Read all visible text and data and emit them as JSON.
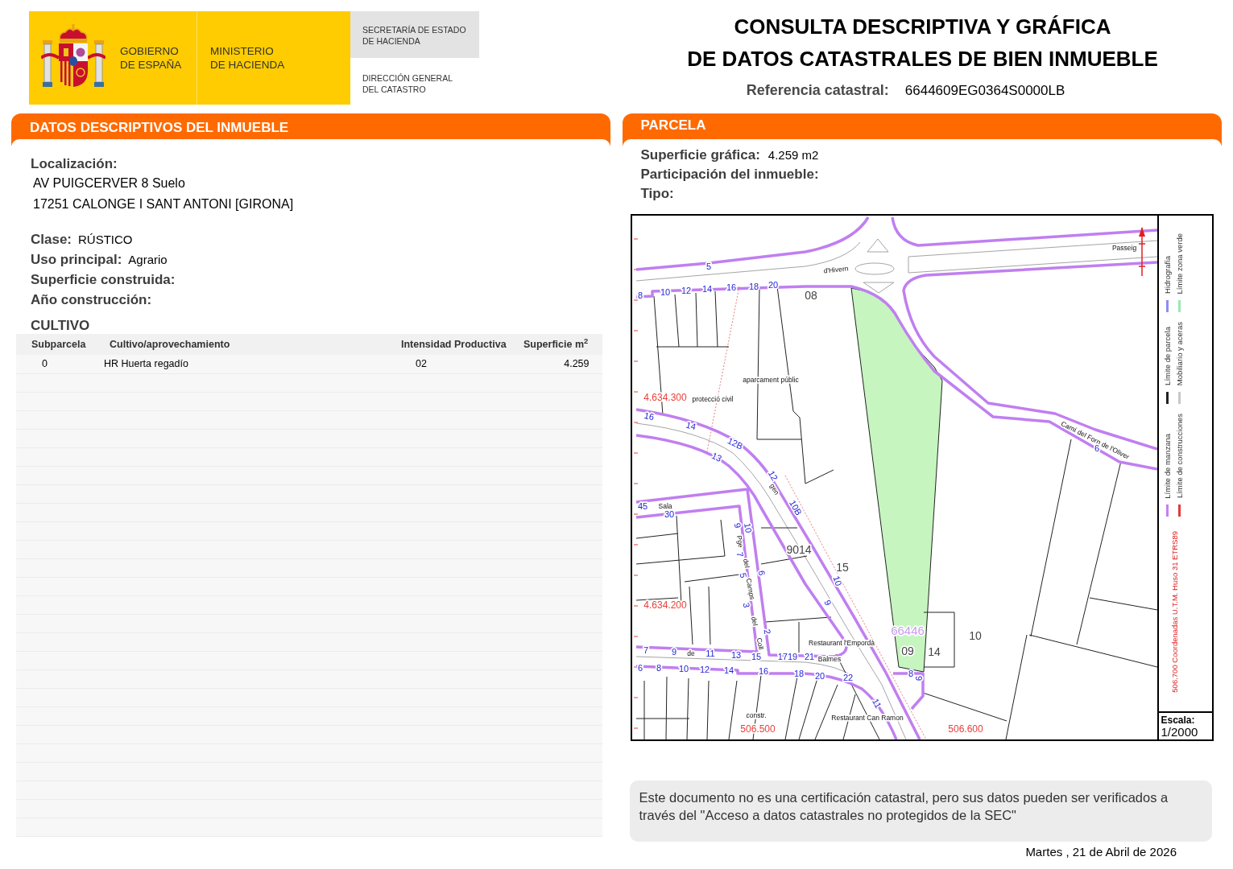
{
  "header": {
    "logo": {
      "government": "GOBIERNO\nDE ESPAÑA",
      "ministry": "MINISTERIO\nDE HACIENDA",
      "secretariat": "SECRETARÍA DE ESTADO\nDE HACIENDA",
      "directorate": "DIRECCIÓN GENERAL\nDEL CATASTRO"
    },
    "title": "CONSULTA DESCRIPTIVA Y GRÁFICA\nDE DATOS CATASTRALES DE BIEN INMUEBLE",
    "reference": {
      "label": "Referencia catastral:",
      "value": "6644609EG0364S0000LB"
    }
  },
  "property_panel": {
    "title": "DATOS DESCRIPTIVOS DEL INMUEBLE",
    "location": {
      "label": "Localización:",
      "lines": [
        "AV PUIGCERVER 8 Suelo",
        "17251 CALONGE I SANT ANTONI [GIRONA]"
      ]
    },
    "fields": [
      {
        "label": "Clase:",
        "value": "RÚSTICO"
      },
      {
        "label": "Uso principal:",
        "value": "Agrario"
      },
      {
        "label": "Superficie construida:"
      },
      {
        "label": "Año construcción:"
      }
    ],
    "crops": {
      "title": "CULTIVO",
      "columns": [
        "Subparcela",
        "Cultivo/aprovechamiento",
        "Intensidad Productiva",
        "Superficie m$^{2}$"
      ],
      "rows": [
        [
          "0",
          "HR Huerta regadío",
          "02",
          "4.259"
        ]
      ]
    }
  },
  "parcel_panel": {
    "title": "PARCELA",
    "fields": [
      {
        "label": "Superficie gráfica:",
        "value": "4.259 m2"
      },
      {
        "label": "Participación del inmueble:"
      },
      {
        "label": "Tipo:"
      }
    ],
    "map": {
      "labels": [
        {
          "text": "5",
          "kind": "number"
        },
        {
          "text": "d'Hivern",
          "kind": "street"
        },
        {
          "text": "Passeig",
          "kind": "street"
        },
        {
          "text": "8",
          "kind": "number"
        },
        {
          "text": "10",
          "kind": "number"
        },
        {
          "text": "12",
          "kind": "number"
        },
        {
          "text": "14",
          "kind": "number"
        },
        {
          "text": "16",
          "kind": "number"
        },
        {
          "text": "18",
          "kind": "number"
        },
        {
          "text": "20",
          "kind": "number"
        },
        {
          "text": "08",
          "kind": "parcel"
        },
        {
          "text": "aparcament públic",
          "kind": "place"
        },
        {
          "text": "4.634.300",
          "kind": "coordinate"
        },
        {
          "text": "protecció civil",
          "kind": "place"
        },
        {
          "text": "16",
          "kind": "number"
        },
        {
          "text": "14",
          "kind": "number"
        },
        {
          "text": "12B",
          "kind": "number"
        },
        {
          "text": "13",
          "kind": "number"
        },
        {
          "text": "12",
          "kind": "number"
        },
        {
          "text": "gen",
          "kind": "street"
        },
        {
          "text": "10B",
          "kind": "number"
        },
        {
          "text": "Camí del Forn de l'Oliver",
          "kind": "street"
        },
        {
          "text": "6",
          "kind": "number"
        },
        {
          "text": "45",
          "kind": "number"
        },
        {
          "text": "Sala",
          "kind": "street"
        },
        {
          "text": "30",
          "kind": "number"
        },
        {
          "text": "9",
          "kind": "number"
        },
        {
          "text": "10",
          "kind": "number"
        },
        {
          "text": "Pge",
          "kind": "street"
        },
        {
          "text": "7",
          "kind": "number"
        },
        {
          "text": "del",
          "kind": "street"
        },
        {
          "text": "5",
          "kind": "number"
        },
        {
          "text": "6",
          "kind": "number"
        },
        {
          "text": "Camps",
          "kind": "street"
        },
        {
          "text": "3",
          "kind": "number"
        },
        {
          "text": "9014",
          "kind": "parcel"
        },
        {
          "text": "15",
          "kind": "parcel"
        },
        {
          "text": "10",
          "kind": "number"
        },
        {
          "text": "4.634.200",
          "kind": "coordinate"
        },
        {
          "text": "9",
          "kind": "number"
        },
        {
          "text": "del",
          "kind": "street"
        },
        {
          "text": "2",
          "kind": "number"
        },
        {
          "text": "Coll",
          "kind": "street"
        },
        {
          "text": "Restaurant l'Empordà",
          "kind": "place"
        },
        {
          "text": "66446",
          "kind": "reference"
        },
        {
          "text": "09",
          "kind": "parcel"
        },
        {
          "text": "14",
          "kind": "parcel"
        },
        {
          "text": "10",
          "kind": "parcel"
        },
        {
          "text": "7",
          "kind": "number"
        },
        {
          "text": "9",
          "kind": "number"
        },
        {
          "text": "de",
          "kind": "street"
        },
        {
          "text": "11",
          "kind": "number"
        },
        {
          "text": "13",
          "kind": "number"
        },
        {
          "text": "15",
          "kind": "number"
        },
        {
          "text": "1719",
          "kind": "number"
        },
        {
          "text": "21",
          "kind": "number"
        },
        {
          "text": "Balmes",
          "kind": "street"
        },
        {
          "text": "6",
          "kind": "number"
        },
        {
          "text": "8",
          "kind": "number"
        },
        {
          "text": "10",
          "kind": "number"
        },
        {
          "text": "12",
          "kind": "number"
        },
        {
          "text": "14",
          "kind": "number"
        },
        {
          "text": "16",
          "kind": "number"
        },
        {
          "text": "18",
          "kind": "number"
        },
        {
          "text": "20",
          "kind": "number"
        },
        {
          "text": "22",
          "kind": "number"
        },
        {
          "text": "8",
          "kind": "number"
        },
        {
          "text": "9",
          "kind": "number"
        },
        {
          "text": "11",
          "kind": "number"
        },
        {
          "text": "constr.",
          "kind": "place"
        },
        {
          "text": "Restaurant Can Ramon",
          "kind": "place"
        },
        {
          "text": "506.500",
          "kind": "coordinate"
        },
        {
          "text": "506.600",
          "kind": "coordinate"
        }
      ],
      "legend_columns": [
        {
          "items": [
            {
              "label": "Límite de manzana",
              "color": "#c27ff2"
            },
            {
              "label": "Límite de parcela",
              "color": "#222222"
            },
            {
              "label": "Hidrografía",
              "color": "#8c8cf5"
            }
          ]
        },
        {
          "items": [
            {
              "label": "Límite de construcciones",
              "color": "#e03a3a"
            },
            {
              "label": "Mobiliario y aceras",
              "color": "#c8c8c8"
            },
            {
              "label": "Límite zona verde",
              "color": "#9be8b4"
            }
          ]
        }
      ],
      "coordinate_note": "506.700 Coordenadas U.T.M. Huso 31 ETRS89",
      "scale": {
        "label": "Escala:",
        "value": "1/2000"
      }
    }
  },
  "notice": "Este documento no es una certificación catastral, pero sus datos pueden ser verificados a través del \"Acceso a datos catastrales no protegidos de la SEC\"",
  "date": "Martes , 21 de Abril de 2026"
}
